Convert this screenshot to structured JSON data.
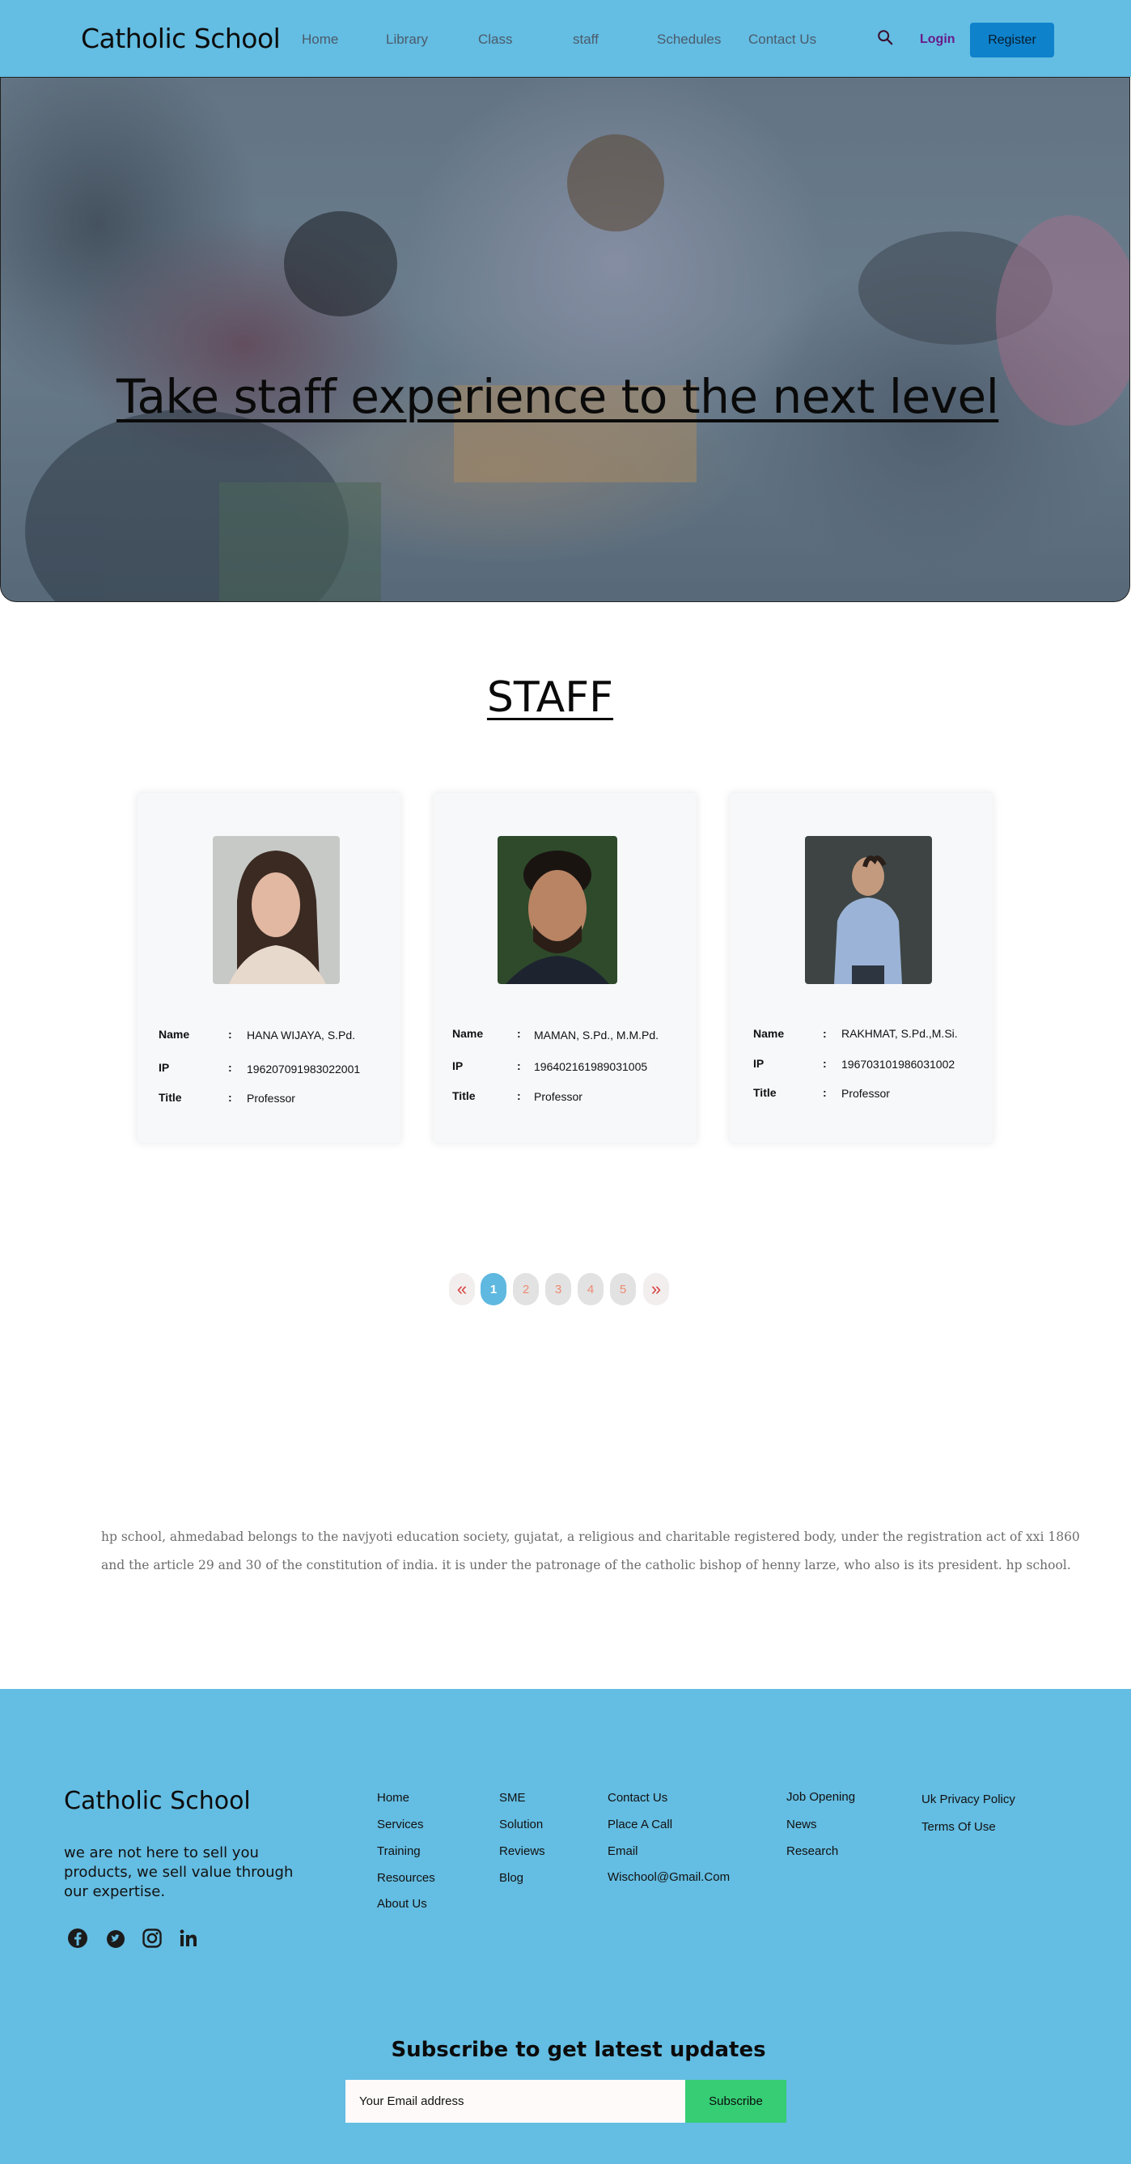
{
  "header": {
    "brand": "Catholic School",
    "nav": [
      "Home",
      "Library",
      "Class",
      "staff",
      "Schedules",
      "Contact Us"
    ],
    "search_icon": "search-icon",
    "login_label": "Login",
    "register_label": "Register"
  },
  "hero": {
    "title": "Take staff experience to the next level"
  },
  "staff": {
    "title": "STAFF",
    "labels": {
      "name": "Name",
      "ip": "IP",
      "title": "Title",
      "colon": ":"
    },
    "cards": [
      {
        "name": "HANA WIJAYA, S.Pd.",
        "ip": "196207091983022001",
        "title": "Professor"
      },
      {
        "name": "MAMAN, S.Pd., M.M.Pd.",
        "ip": "196402161989031005",
        "title": "Professor"
      },
      {
        "name": "RAKHMAT, S.Pd.,M.Si.",
        "ip": "196703101986031002",
        "title": "Professor"
      }
    ]
  },
  "pagination": {
    "prev": "«",
    "next": "»",
    "pages": [
      "1",
      "2",
      "3",
      "4",
      "5"
    ],
    "active_page": "1"
  },
  "about": {
    "text": "hp school, ahmedabad belongs to the navjyoti education society, gujatat, a religious and charitable registered body, under the registration act of xxi 1860 and the article 29 and 30 of the constitution of india. it is under the patronage of the catholic bishop of henny larze, who also is its president. hp school."
  },
  "footer": {
    "brand": "Catholic School",
    "tagline": "we are not here to sell you products, we sell value through our expertise.",
    "social_icons": [
      "facebook-icon",
      "twitter-icon",
      "instagram-icon",
      "linkedin-icon"
    ],
    "col1": [
      "Home",
      "Services",
      "Training",
      "Resources",
      "About Us"
    ],
    "col2": [
      "SME",
      "Solution",
      "Reviews",
      "Blog"
    ],
    "col3": [
      "Contact Us",
      "Place A Call",
      "Email",
      "Wischool@Gmail.Com"
    ],
    "col4": [
      "Job Opening",
      "News",
      "Research"
    ],
    "col5": [
      "Uk Privacy Policy",
      "Terms Of Use"
    ],
    "subscribe_title": "Subscribe to get latest updates",
    "email_placeholder": "Your Email address",
    "subscribe_label": "Subscribe"
  },
  "colors": {
    "header_bg": "#64bde2",
    "register_bg": "#0f82cc",
    "login_text": "#6a1b8a",
    "pager_active": "#5fb8e0",
    "subscribe_bg": "#36cd75"
  }
}
